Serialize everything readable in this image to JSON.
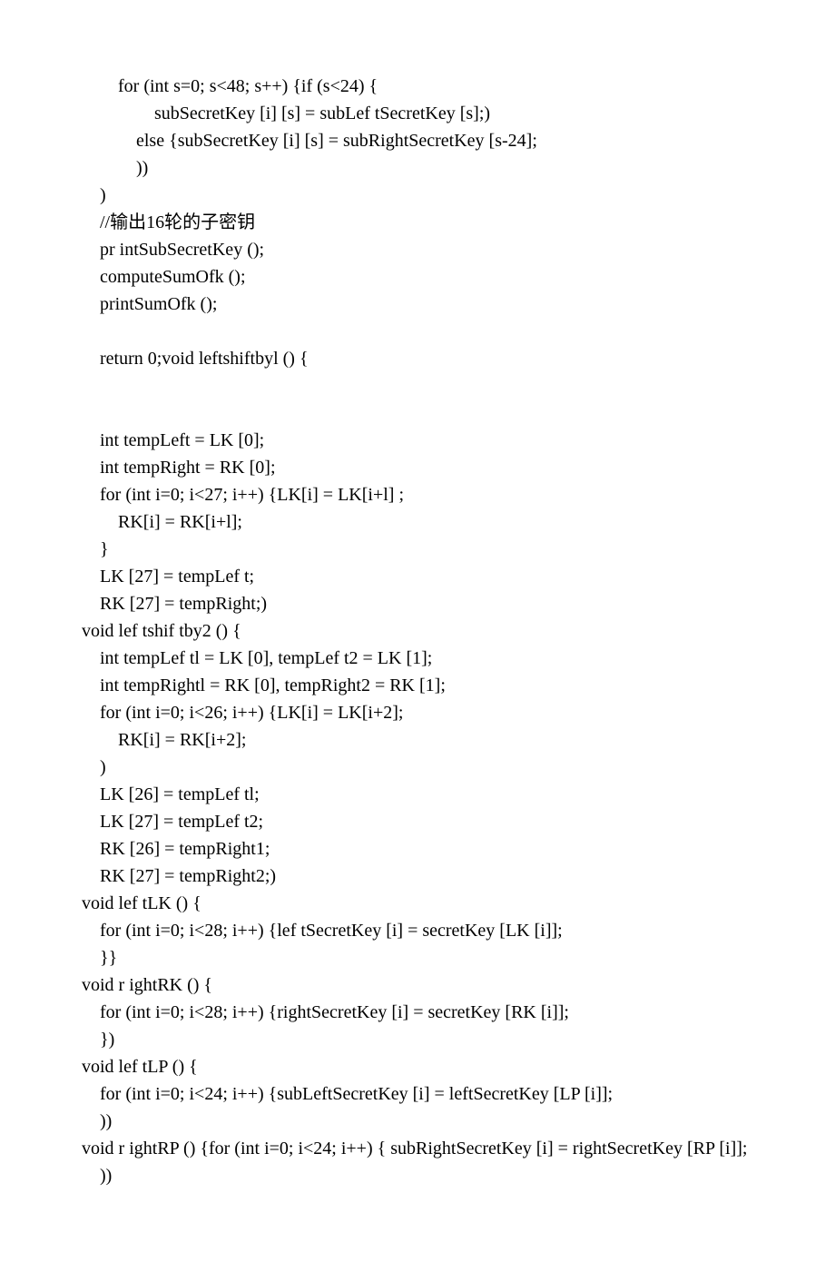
{
  "lines": [
    "        for (int s=0; s<48; s++) {if (s<24) {",
    "                subSecretKey [i] [s] = subLef tSecretKey [s];)",
    "            else {subSecretKey [i] [s] = subRightSecretKey [s-24];",
    "            ))",
    "    )",
    "    //输出16轮的子密钥",
    "    pr intSubSecretKey ();",
    "    computeSumOfk ();",
    "    printSumOfk ();",
    "",
    "    return 0;void leftshiftbyl () {",
    "",
    "",
    "    int tempLeft = LK [0];",
    "    int tempRight = RK [0];",
    "    for (int i=0; i<27; i++) {LK[i] = LK[i+l] ;",
    "        RK[i] = RK[i+l];",
    "    }",
    "    LK [27] = tempLef t;",
    "    RK [27] = tempRight;)",
    "void lef tshif tby2 () {",
    "    int tempLef tl = LK [0], tempLef t2 = LK [1];",
    "    int tempRightl = RK [0], tempRight2 = RK [1];",
    "    for (int i=0; i<26; i++) {LK[i] = LK[i+2];",
    "        RK[i] = RK[i+2];",
    "    )",
    "    LK [26] = tempLef tl;",
    "    LK [27] = tempLef t2;",
    "    RK [26] = tempRight1;",
    "    RK [27] = tempRight2;)",
    "void lef tLK () {",
    "    for (int i=0; i<28; i++) {lef tSecretKey [i] = secretKey [LK [i]];",
    "    }}",
    "void r ightRK () {",
    "    for (int i=0; i<28; i++) {rightSecretKey [i] = secretKey [RK [i]];",
    "    })",
    "void lef tLP () {",
    "    for (int i=0; i<24; i++) {subLeftSecretKey [i] = leftSecretKey [LP [i]];",
    "    ))",
    "void r ightRP () {for (int i=0; i<24; i++) { subRightSecretKey [i] = rightSecretKey [RP [i]];",
    "    ))"
  ]
}
